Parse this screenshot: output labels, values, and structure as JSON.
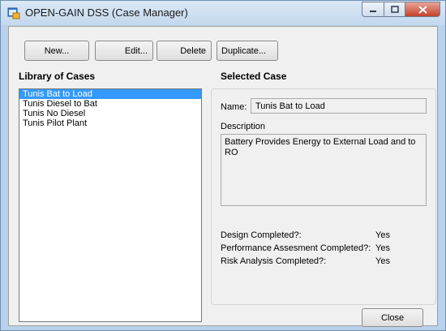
{
  "window": {
    "title": "OPEN-GAIN DSS (Case Manager)"
  },
  "toolbar": {
    "new_label": "New...",
    "edit_label": "Edit...",
    "delete_label": "Delete",
    "duplicate_label": "Duplicate..."
  },
  "library": {
    "heading": "Library of Cases",
    "items": [
      "Tunis Bat to Load",
      "Tunis Diesel to Bat",
      "Tunis No Diesel",
      "Tunis Pilot Plant"
    ],
    "selected_index": 0
  },
  "selected_case": {
    "heading": "Selected Case",
    "name_label": "Name:",
    "name_value": "Tunis Bat to Load",
    "description_label": "Description",
    "description_value": "Battery Provides Energy to External Load and to RO",
    "status": [
      {
        "label": "Design Completed?:",
        "value": "Yes"
      },
      {
        "label": "Performance Assesment Completed?:",
        "value": "Yes"
      },
      {
        "label": "Risk Analysis Completed?:",
        "value": "Yes"
      }
    ]
  },
  "footer": {
    "close_label": "Close"
  },
  "icons": {
    "app": "app-window-icon",
    "minimize": "minimize-icon",
    "maximize": "maximize-icon",
    "close": "close-icon"
  }
}
